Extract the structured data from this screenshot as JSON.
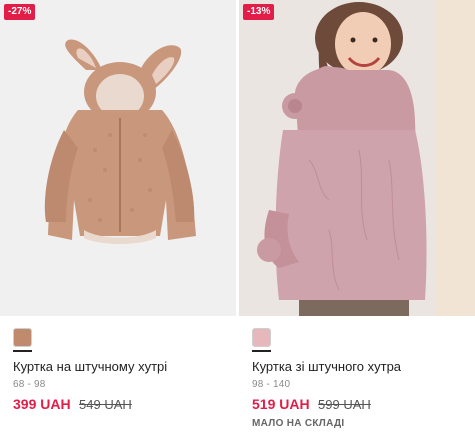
{
  "products": [
    {
      "badge": "-27%",
      "image_alt": "Brown teddy fur jacket with bunny ears hood",
      "swatch_color": "#c08a6e",
      "title": "Куртка на штучному хутрі",
      "sizes": "68 - 98",
      "price": "399 UAH",
      "old_price": "549 UAH",
      "stock_note": ""
    },
    {
      "badge": "-13%",
      "image_alt": "Girl wearing pink faux fur jacket with bear ears hood",
      "swatch_color": "#e7b8bb",
      "title": "Куртка зі штучного хутра",
      "sizes": "98 - 140",
      "price": "519 UAH",
      "old_price": "599 UAH",
      "stock_note": "МАЛО НА СКЛАДІ"
    }
  ],
  "colors": {
    "sale_red": "#e11d48",
    "photo_bg_left": "#f0f0f0",
    "photo_bg_right": "#eae5e1"
  }
}
